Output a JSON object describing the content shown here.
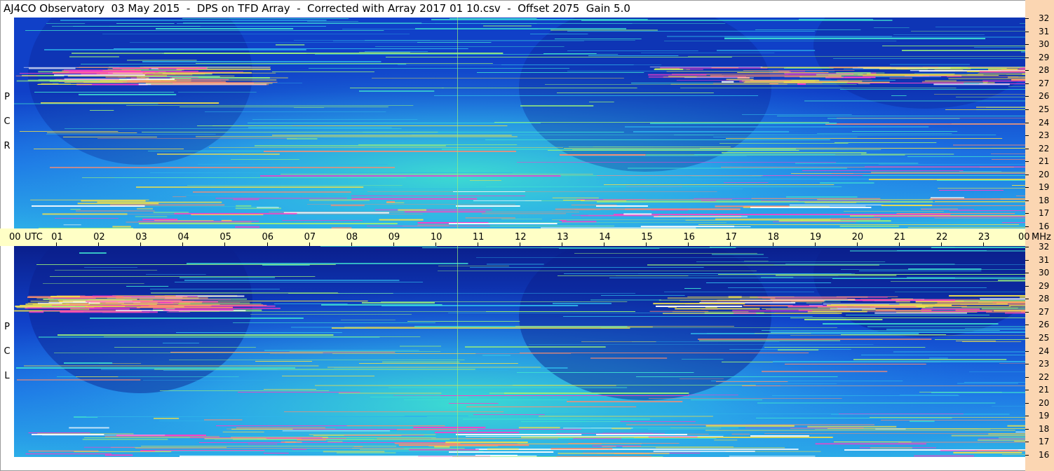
{
  "chart_data": {
    "type": "heatmap",
    "title": "AJ4CO Observatory  03 May 2015  -  DPS on TFD Array  -  Corrected with Array 2017 01 10.csv  -  Offset 2075  Gain 5.0",
    "panels": [
      {
        "name": "RCP",
        "label_letters": [
          "P",
          "C",
          "R"
        ]
      },
      {
        "name": "LCP",
        "label_letters": [
          "P",
          "C",
          "L"
        ]
      }
    ],
    "x_axis": {
      "unit": "UTC",
      "ticks": [
        "00",
        "01",
        "02",
        "03",
        "04",
        "05",
        "06",
        "07",
        "08",
        "09",
        "10",
        "11",
        "12",
        "13",
        "14",
        "15",
        "16",
        "17",
        "18",
        "19",
        "20",
        "21",
        "22",
        "23",
        "00"
      ],
      "range": [
        0,
        24
      ]
    },
    "y_axis": {
      "unit": "MHz",
      "ticks": [
        "32",
        "31",
        "30",
        "29",
        "28",
        "27",
        "26",
        "25",
        "24",
        "23",
        "22",
        "21",
        "20",
        "19",
        "18",
        "17",
        "16"
      ],
      "range": [
        16,
        32
      ]
    },
    "colormap": [
      "#0a1f8c",
      "#1040c8",
      "#1e78e6",
      "#2eb4e8",
      "#3ee0d0",
      "#9af07a",
      "#f0e04a",
      "#ff8c6e",
      "#ff3cc8",
      "#ffffff"
    ]
  }
}
